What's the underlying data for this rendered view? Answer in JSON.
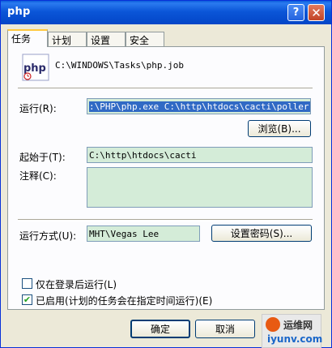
{
  "window": {
    "title": "php"
  },
  "title_buttons": {
    "help": "?",
    "close": "✕"
  },
  "tabs": [
    {
      "label": "任务",
      "active": true
    },
    {
      "label": "计划",
      "active": false
    },
    {
      "label": "设置",
      "active": false
    },
    {
      "label": "安全",
      "active": false
    }
  ],
  "task": {
    "icon_text": "php",
    "job_path": "C:\\WINDOWS\\Tasks\\php.job",
    "run_label": "运行(R):",
    "run_value": ":\\PHP\\php.exe C:\\http\\htdocs\\cacti\\poller.php",
    "browse_label": "浏览(B)...",
    "start_in_label": "起始于(T):",
    "start_in_value": "C:\\http\\htdocs\\cacti",
    "comment_label": "注释(C):",
    "comment_value": "",
    "run_as_label": "运行方式(U):",
    "run_as_value": "MHT\\Vegas Lee",
    "set_password_label": "设置密码(S)...",
    "only_logged_on_label": "仅在登录后运行(L)",
    "only_logged_on_checked": false,
    "enabled_label": "已启用(计划的任务会在指定时间运行)(E)",
    "enabled_checked": true
  },
  "footer": {
    "ok_label": "确定",
    "cancel_label": "取消"
  },
  "watermark": {
    "line1": "运维网",
    "line2": "iyunv.com"
  },
  "colors": {
    "title_blue": "#0a5cdb",
    "field_green": "#d4ecd8",
    "selection": "#316ac5"
  }
}
